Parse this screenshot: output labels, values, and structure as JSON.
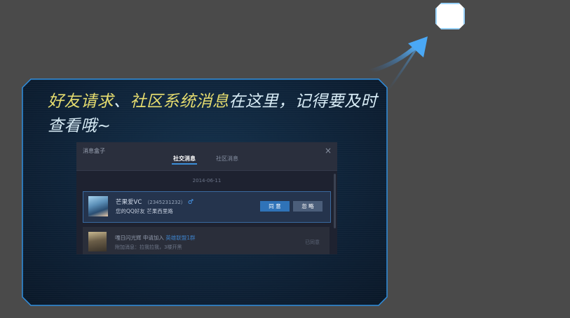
{
  "tip": {
    "text_highlight_1": "好友请求",
    "text_sep": "、",
    "text_highlight_2": "社区系统消息",
    "text_rest": "在这里，记得要及时查看哦~"
  },
  "msgbox": {
    "title": "消息盒子",
    "close_glyph": "×",
    "tabs": [
      "社交消息",
      "社区消息"
    ],
    "date": "2014-06-11",
    "request": {
      "name": "芒果爱VC",
      "id": "（2345231232）",
      "gender_glyph": "♂",
      "desc": "您的QQ好友 芒果西里路",
      "agree_label": "同 意",
      "ignore_label": "忽 略"
    },
    "history": {
      "name": "嘎日闪光辉",
      "action": " 申请加入 ",
      "group": "英雄联盟1群",
      "note": "附加消息：拉我拉我，3楼开黑",
      "status": "已同意"
    }
  },
  "colors": {
    "accent": "#3c8fd8",
    "highlight_text": "#e6dd6f"
  }
}
